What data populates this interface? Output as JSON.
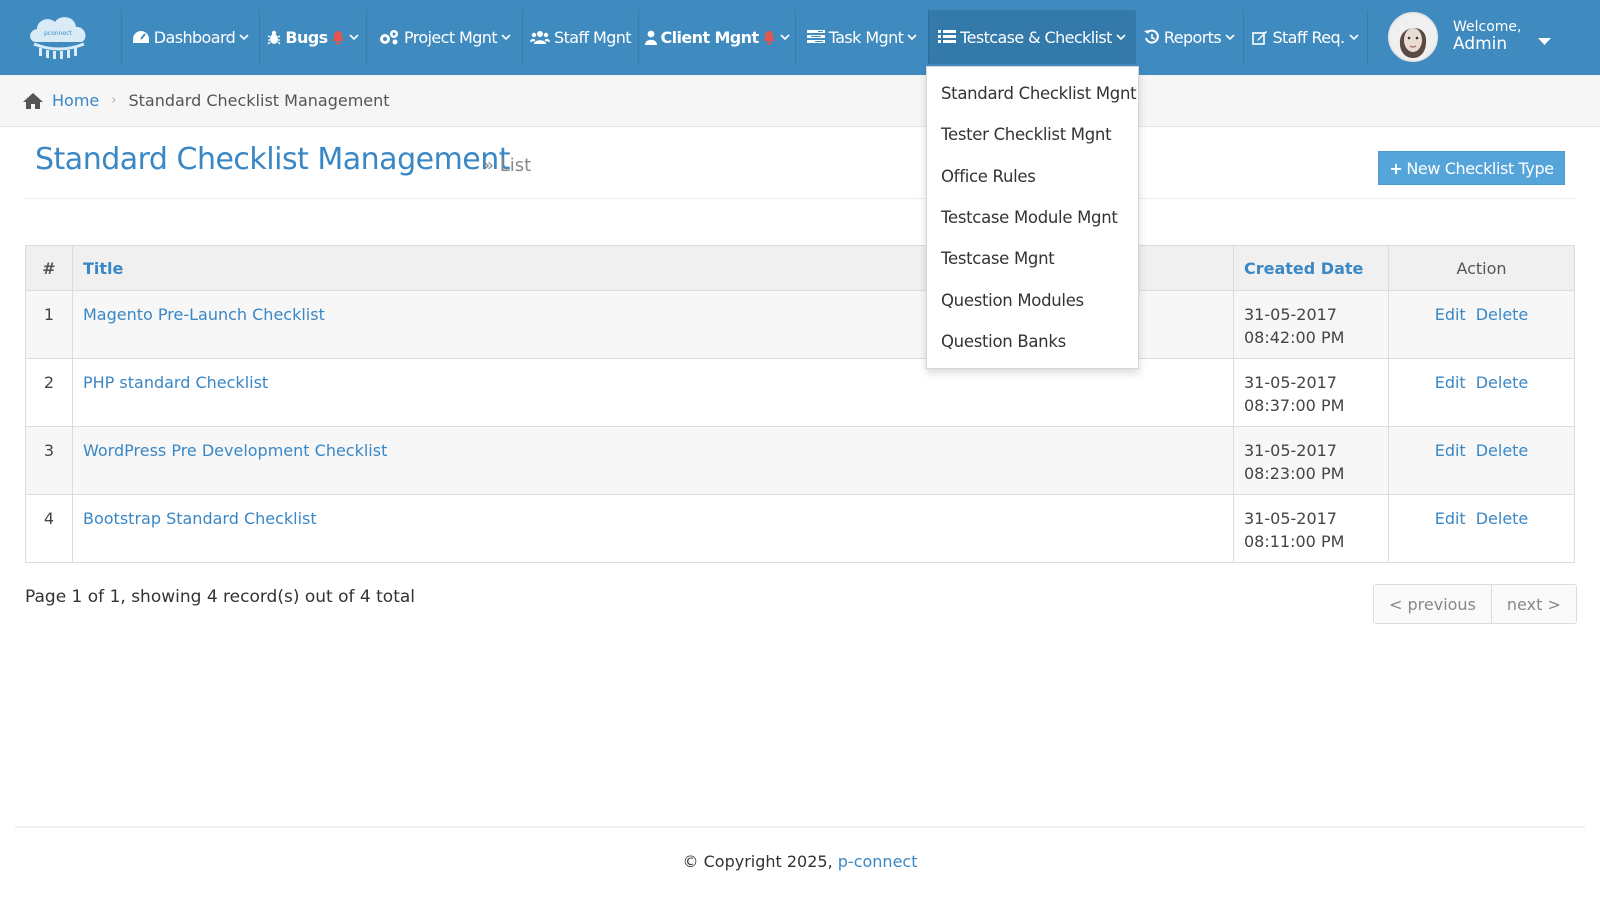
{
  "colors": {
    "navbar": "#3f8bbf",
    "active_nav": "#337aab",
    "link": "#3a87c5",
    "primary_button": "#55a5db",
    "bell": "#e2574c"
  },
  "brand": {
    "logo_text": "pconnect",
    "logo_icon": "cloud-logo-icon"
  },
  "nav": {
    "items": [
      {
        "label": "Dashboard",
        "icon": "dashboard-icon"
      },
      {
        "label": "Bugs",
        "icon": "bug-icon"
      },
      {
        "label": "Project Mgnt",
        "icon": "cogs-icon"
      },
      {
        "label": "Staff Mgnt",
        "icon": "users-icon"
      },
      {
        "label": "Client Mgnt",
        "icon": "user-icon"
      },
      {
        "label": "Task Mgnt",
        "icon": "tasks-icon"
      },
      {
        "label": "Testcase & Checklist",
        "icon": "list-icon"
      },
      {
        "label": "Reports",
        "icon": "history-icon"
      },
      {
        "label": "Staff Req.",
        "icon": "edit-icon"
      }
    ]
  },
  "user": {
    "welcome": "Welcome,",
    "name": "Admin"
  },
  "breadcrumb": {
    "home": "Home",
    "current": "Standard Checklist Management"
  },
  "page": {
    "title": "Standard Checklist Management",
    "subtitle": "» List",
    "new_button": "New Checklist Type"
  },
  "table": {
    "headers": {
      "num": "#",
      "title": "Title",
      "created": "Created Date",
      "action": "Action"
    },
    "rows": [
      {
        "num": "1",
        "title": "Magento Pre-Launch Checklist",
        "date": "31-05-2017",
        "time": "08:42:00 PM",
        "edit": "Edit",
        "delete": "Delete"
      },
      {
        "num": "2",
        "title": "PHP standard Checklist",
        "date": "31-05-2017",
        "time": "08:37:00 PM",
        "edit": "Edit",
        "delete": "Delete"
      },
      {
        "num": "3",
        "title": "WordPress Pre Development Checklist",
        "date": "31-05-2017",
        "time": "08:23:00 PM",
        "edit": "Edit",
        "delete": "Delete"
      },
      {
        "num": "4",
        "title": "Bootstrap Standard Checklist",
        "date": "31-05-2017",
        "time": "08:11:00 PM",
        "edit": "Edit",
        "delete": "Delete"
      }
    ]
  },
  "pagination": {
    "info": "Page 1 of 1, showing 4 record(s) out of 4 total",
    "previous": "< previous",
    "next": "next >"
  },
  "footer": {
    "copyright": "© Copyright 2025,",
    "link": "p-connect"
  },
  "dropdown": {
    "items": [
      "Standard Checklist Mgnt",
      "Tester Checklist Mgnt",
      "Office Rules",
      "Testcase Module Mgnt",
      "Testcase Mgnt",
      "Question Modules",
      "Question Banks"
    ]
  }
}
